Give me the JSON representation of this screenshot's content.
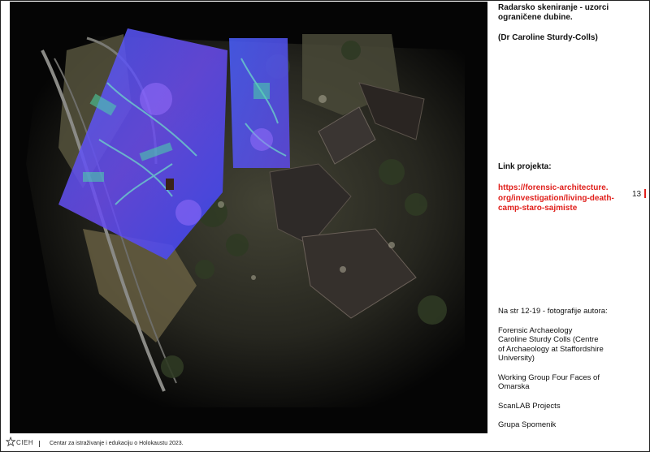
{
  "caption": {
    "line1": "Radarsko skeniranje - uzorci",
    "line2": "ograničene dubine.",
    "author": "(Dr Caroline Sturdy-Colls)"
  },
  "link": {
    "label": "Link projekta:",
    "url_line1": "https://forensic-architecture.",
    "url_line2": "org/investigation/living-death-",
    "url_line3": "camp-staro-sajmiste"
  },
  "page_number": "13",
  "credits": {
    "intro": "Na str 12-19 - fotografije autora:",
    "item1_line1": "Forensic Archaeology",
    "item1_line2": "Caroline Sturdy Colls (Centre",
    "item1_line3": "of Archaeology at Staffordshire",
    "item1_line4": "University)",
    "item2_line1": "Working Group Four Faces of",
    "item2_line2": "Omarska",
    "item3": "ScanLAB Projects",
    "item4": "Grupa Spomenik"
  },
  "footer": {
    "logo_text": "CIEH",
    "text": "Centar za istraživanje i edukaciju o Holokaustu 2023."
  },
  "colors": {
    "accent": "#e0201c",
    "scan_blue": "#3a4cff"
  }
}
